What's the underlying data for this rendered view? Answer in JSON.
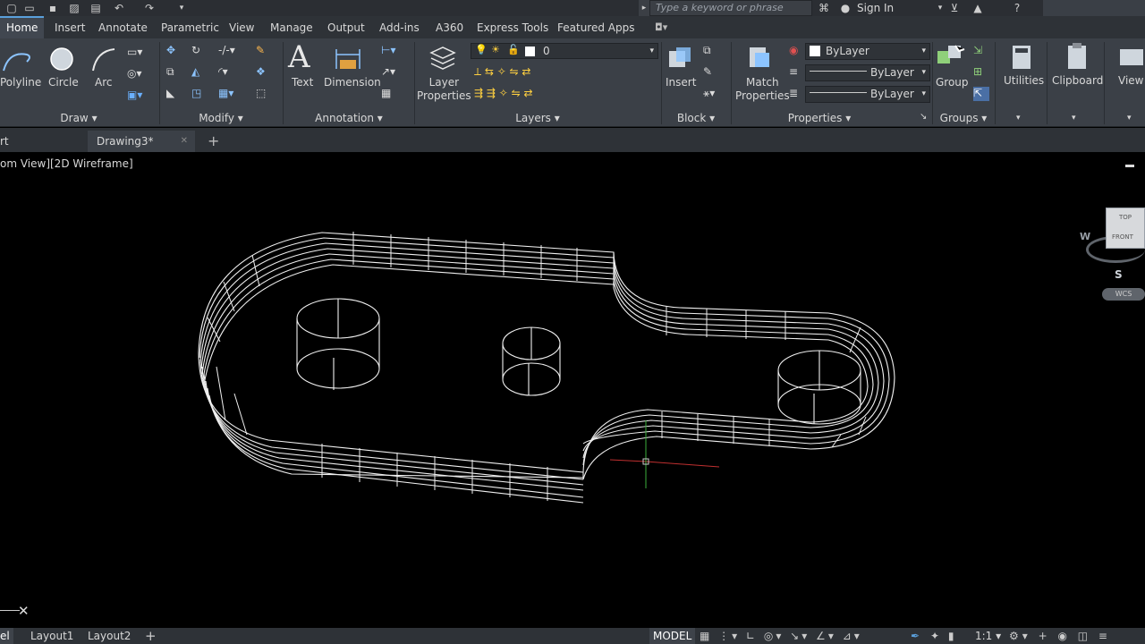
{
  "quick_access": {
    "search_placeholder": "Type a keyword or phrase",
    "sign_in": "Sign In"
  },
  "tabs": [
    "Home",
    "Insert",
    "Annotate",
    "Parametric",
    "View",
    "Manage",
    "Output",
    "Add-ins",
    "A360",
    "Express Tools",
    "Featured Apps"
  ],
  "ribbon": {
    "draw": {
      "polyline": "Polyline",
      "circle": "Circle",
      "arc": "Arc",
      "panel": "Draw"
    },
    "modify": {
      "panel": "Modify"
    },
    "annotation": {
      "text": "Text",
      "dimension": "Dimension",
      "panel": "Annotation"
    },
    "layers": {
      "layer_properties": "Layer\nProperties",
      "current_layer": "0",
      "panel": "Layers"
    },
    "block": {
      "insert": "Insert",
      "panel": "Block"
    },
    "properties": {
      "match_properties": "Match\nProperties",
      "color": "ByLayer",
      "linetype": "ByLayer",
      "lineweight": "ByLayer",
      "panel": "Properties"
    },
    "groups": {
      "group": "Group",
      "panel": "Groups"
    },
    "utilities": "Utilities",
    "clipboard": "Clipboard",
    "view": "View"
  },
  "file_tabs": {
    "partial": "rt",
    "drawing": "Drawing3*"
  },
  "viewport": {
    "label": "om View][2D Wireframe]",
    "viewcube": {
      "top": "TOP",
      "front": "FRONT",
      "west": "W",
      "south": "S",
      "wcs": "WCS"
    }
  },
  "layout_tabs": {
    "partial": "el",
    "layout1": "Layout1",
    "layout2": "Layout2"
  },
  "status": {
    "model": "MODEL",
    "scale": "1:1"
  }
}
